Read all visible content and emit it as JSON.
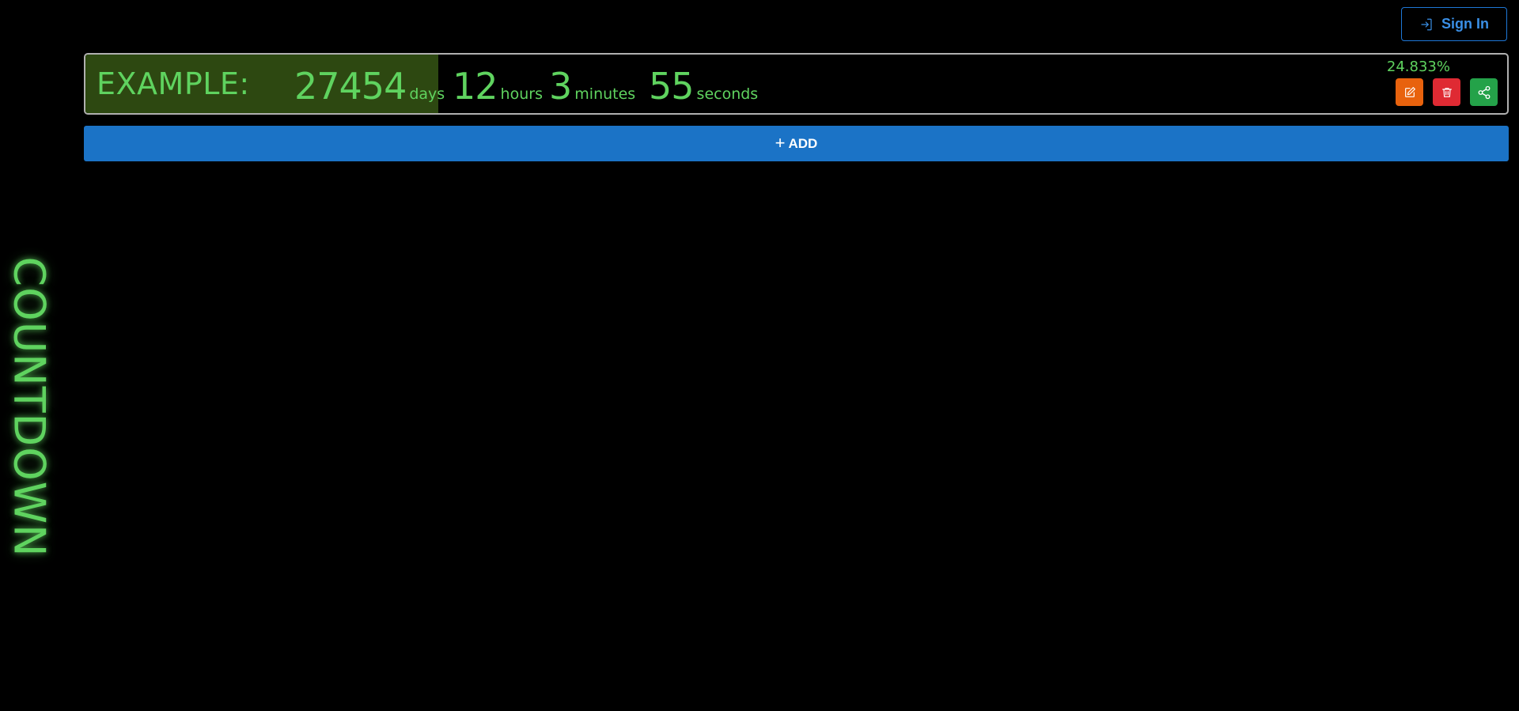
{
  "header": {
    "signin_label": "Sign In",
    "signin_icon": "login-icon"
  },
  "brand": {
    "text": "COUNTDOWN",
    "color": "#5fd35f"
  },
  "countdown": {
    "title": "EXAMPLE:",
    "days": "27454",
    "days_label": "days",
    "hours": "12",
    "hours_label": "hours",
    "minutes": "3",
    "minutes_label": "minutes",
    "seconds": "55",
    "seconds_label": "seconds",
    "percent": "24.833%",
    "progress_fraction": 0.24833,
    "progress_color": "#2d4811",
    "actions": [
      {
        "icon": "edit-icon",
        "color": "#e8620d"
      },
      {
        "icon": "trash-icon",
        "color": "#df2a33"
      },
      {
        "icon": "share-icon",
        "color": "#24a249"
      }
    ]
  },
  "add_button": {
    "label": "ADD",
    "icon": "plus-icon",
    "color": "#1b73c6"
  }
}
